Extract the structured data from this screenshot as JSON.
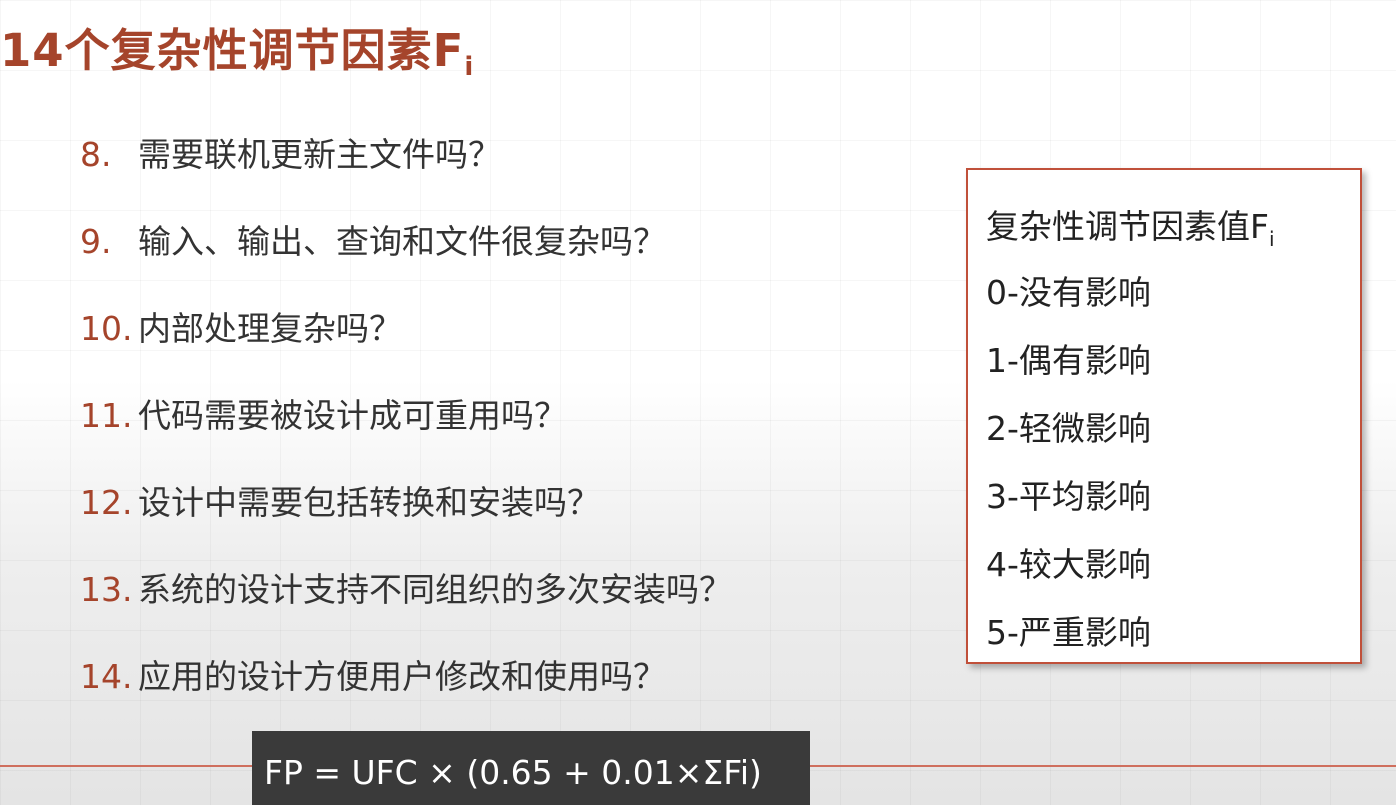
{
  "title": {
    "main": "14个复杂性调节因素F",
    "subscript": "i"
  },
  "questions": [
    {
      "num": "8.",
      "text": "需要联机更新主文件吗？"
    },
    {
      "num": "9.",
      "text": "输入、输出、查询和文件很复杂吗？"
    },
    {
      "num": "10.",
      "text": "内部处理复杂吗？"
    },
    {
      "num": "11.",
      "text": "代码需要被设计成可重用吗？"
    },
    {
      "num": "12.",
      "text": "设计中需要包括转换和安装吗？"
    },
    {
      "num": "13.",
      "text": "系统的设计支持不同组织的多次安装吗？"
    },
    {
      "num": "14.",
      "text": "应用的设计方便用户修改和使用吗？"
    }
  ],
  "legend": {
    "title": "复杂性调节因素值F",
    "subscript": "i",
    "items": [
      "0-没有影响",
      "1-偶有影响",
      "2-轻微影响",
      "3-平均影响",
      "4-较大影响",
      "5-严重影响"
    ]
  },
  "formula": "FP = UFC × (0.65 + 0.01×ΣFi)",
  "colors": {
    "accent": "#a5442b",
    "text": "#333333",
    "legend_border": "#c0503a",
    "formula_bg": "#3a3a3a"
  }
}
